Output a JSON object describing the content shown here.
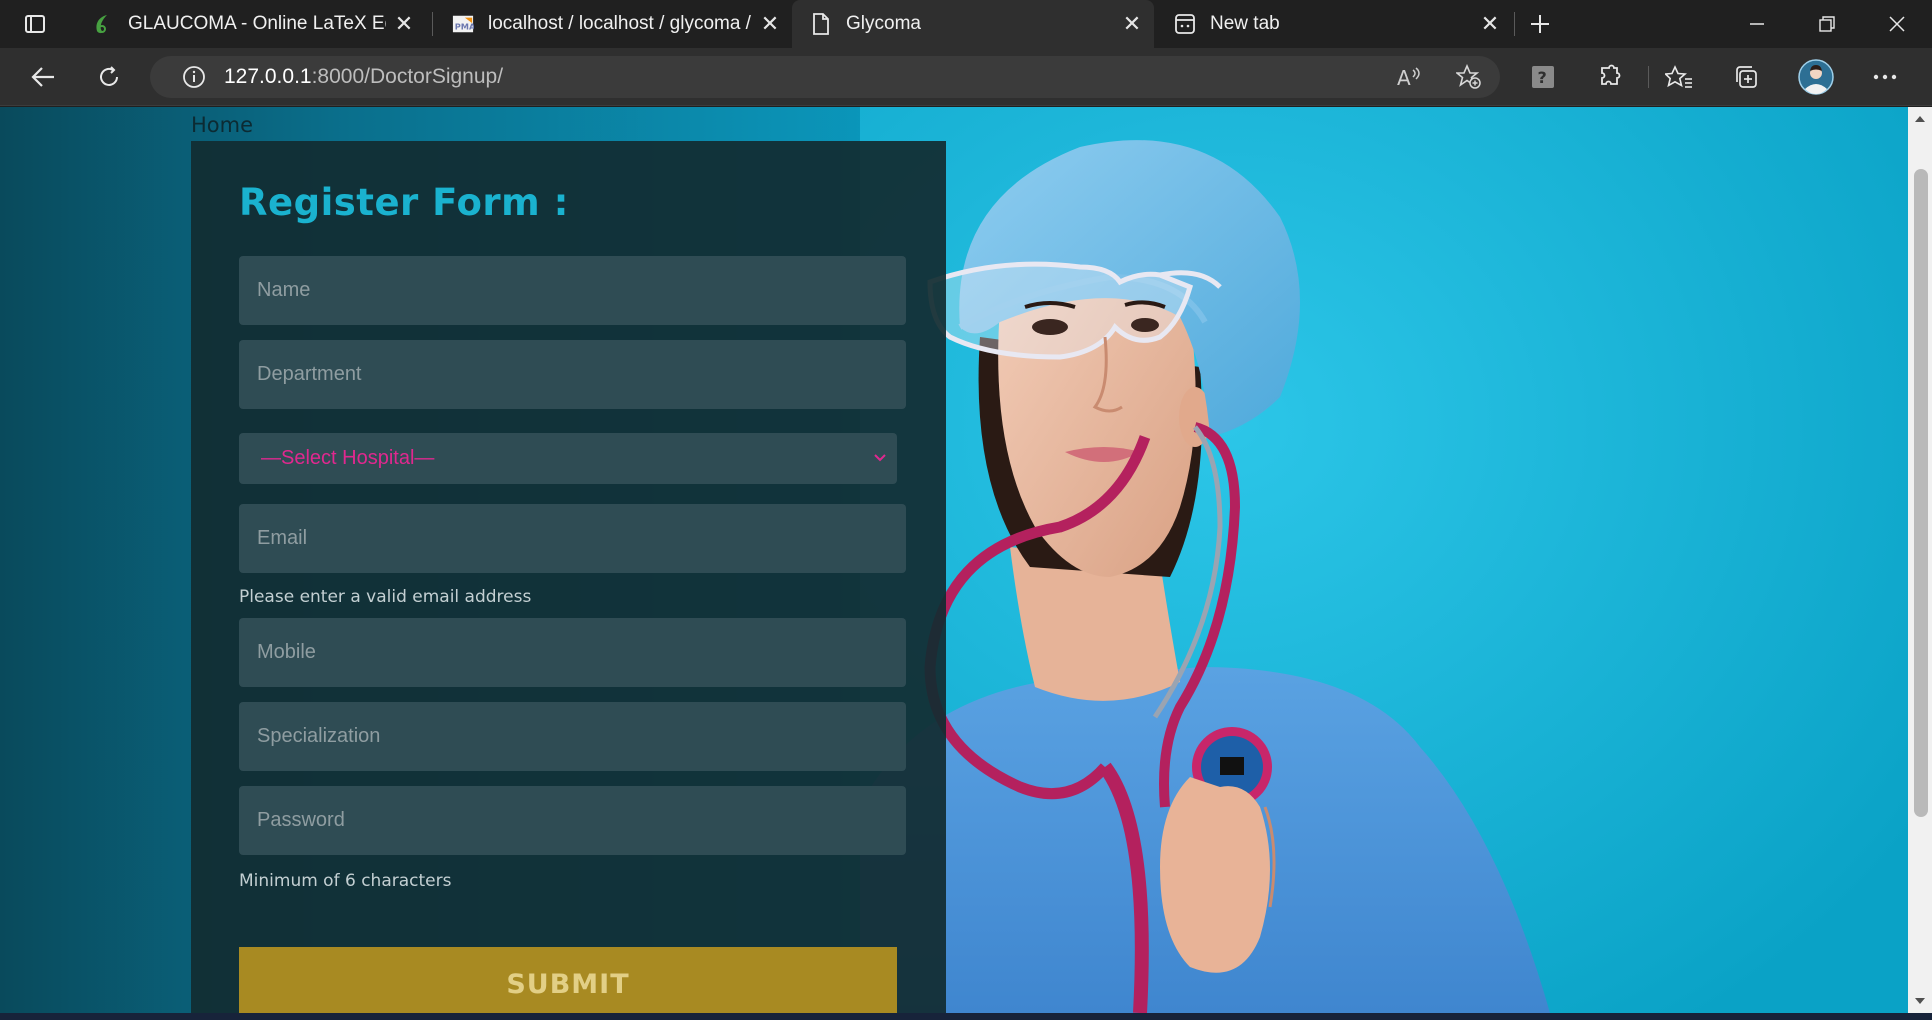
{
  "browser": {
    "tabs": [
      {
        "title": "GLAUCOMA - Online LaTeX Editc",
        "icon": "overleaf-leaf-icon",
        "active": false
      },
      {
        "title": "localhost / localhost / glycoma /",
        "icon": "phpmyadmin-icon",
        "active": false
      },
      {
        "title": "Glycoma",
        "icon": "page-icon",
        "active": true
      },
      {
        "title": "New tab",
        "icon": "new-tab-page-icon",
        "active": false
      }
    ],
    "url_host": "127.0.0.1",
    "url_rest": ":8000/DoctorSignup/"
  },
  "page": {
    "home_link": "Home",
    "form": {
      "title": "Register Form :",
      "name_placeholder": "Name",
      "department_placeholder": "Department",
      "hospital_select": "—Select Hospital—",
      "email_placeholder": "Email",
      "email_hint": "Please enter a valid email address",
      "mobile_placeholder": "Mobile",
      "specialization_placeholder": "Specialization",
      "password_placeholder": "Password",
      "password_hint": "Minimum of 6 characters",
      "submit_label": "SUBMIT"
    }
  },
  "colors": {
    "accent_title": "#1ab2cf",
    "select_text": "#e0288f",
    "submit_bg": "#a88a22"
  }
}
